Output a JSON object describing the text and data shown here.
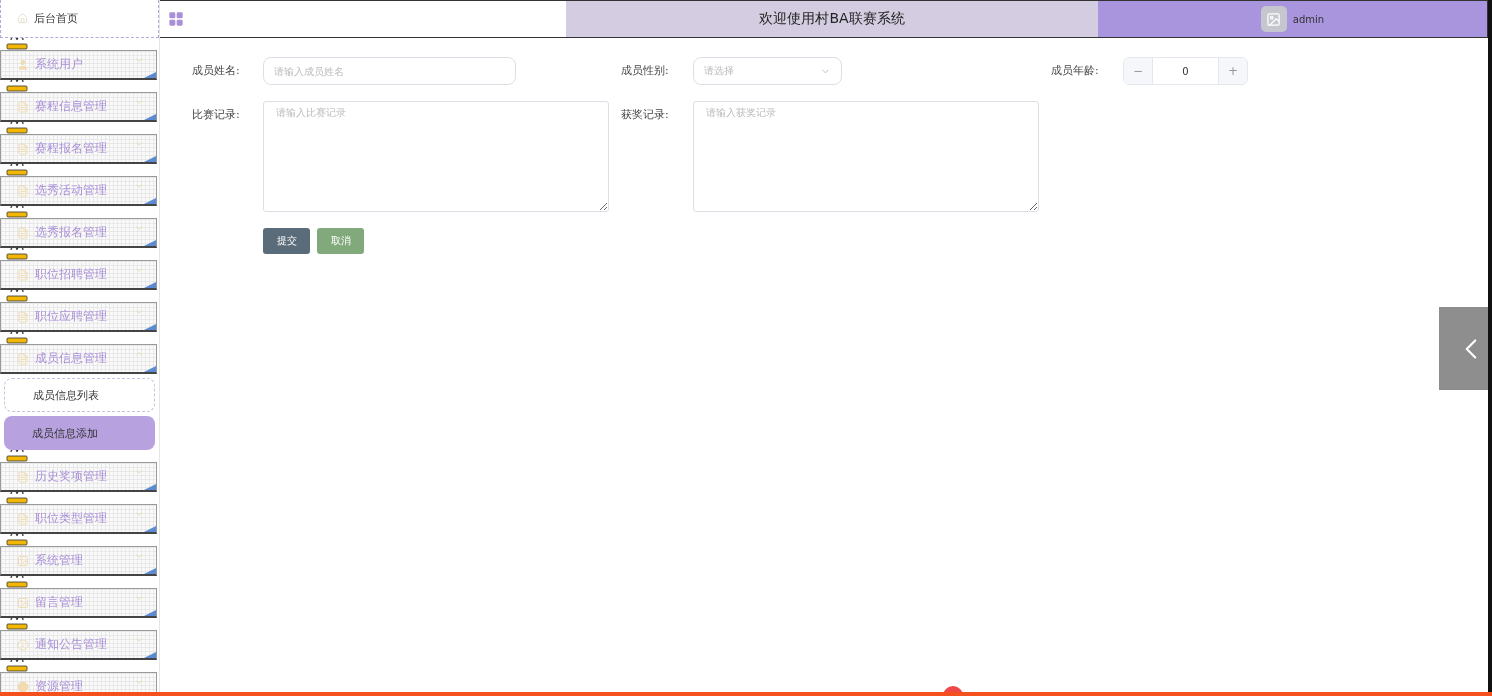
{
  "sidebar": {
    "home": "后台首页",
    "items": [
      {
        "label": "系统用户",
        "expanded": false
      },
      {
        "label": "赛程信息管理",
        "expanded": false
      },
      {
        "label": "赛程报名管理",
        "expanded": false
      },
      {
        "label": "选秀活动管理",
        "expanded": false
      },
      {
        "label": "选秀报名管理",
        "expanded": false
      },
      {
        "label": "职位招聘管理",
        "expanded": false
      },
      {
        "label": "职位应聘管理",
        "expanded": false
      },
      {
        "label": "成员信息管理",
        "expanded": true,
        "children": [
          {
            "label": "成员信息列表",
            "selected": false
          },
          {
            "label": "成员信息添加",
            "selected": true
          }
        ]
      },
      {
        "label": "历史奖项管理",
        "expanded": false
      },
      {
        "label": "职位类型管理",
        "expanded": false
      },
      {
        "label": "系统管理",
        "expanded": false
      },
      {
        "label": "留言管理",
        "expanded": false
      },
      {
        "label": "通知公告管理",
        "expanded": false
      },
      {
        "label": "资源管理",
        "expanded": false
      }
    ]
  },
  "header": {
    "title": "欢迎使用村BA联赛系统",
    "user": "admin"
  },
  "form": {
    "name": {
      "label": "成员姓名:",
      "placeholder": "请输入成员姓名"
    },
    "gender": {
      "label": "成员性别:",
      "placeholder": "请选择"
    },
    "age": {
      "label": "成员年龄:",
      "value": "0",
      "minus": "−",
      "plus": "+"
    },
    "matches": {
      "label": "比赛记录:",
      "placeholder": "请输入比赛记录"
    },
    "awards": {
      "label": "获奖记录:",
      "placeholder": "请输入获奖记录"
    },
    "buttons": [
      "提交",
      "取消"
    ]
  }
}
